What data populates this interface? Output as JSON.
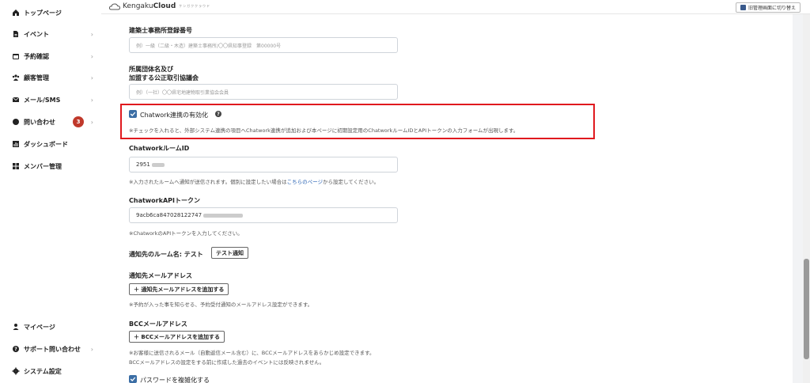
{
  "sidebar": {
    "items": [
      {
        "label": "トップページ",
        "icon": "home-icon",
        "chevron": ""
      },
      {
        "label": "イベント",
        "icon": "document-icon",
        "chevron": "›"
      },
      {
        "label": "予約確認",
        "icon": "calendar-icon",
        "chevron": "›"
      },
      {
        "label": "顧客管理",
        "icon": "users-icon",
        "chevron": "›"
      },
      {
        "label": "メール/SMS",
        "icon": "mail-icon",
        "chevron": "›"
      },
      {
        "label": "問い合わせ",
        "icon": "chat-icon",
        "chevron": "›",
        "badge": "3"
      },
      {
        "label": "ダッシュボード",
        "icon": "chart-icon",
        "chevron": ""
      },
      {
        "label": "メンバー管理",
        "icon": "grid-icon",
        "chevron": ""
      }
    ],
    "bottom_items": [
      {
        "label": "マイページ",
        "icon": "user-icon",
        "chevron": ""
      },
      {
        "label": "サポート問い合わせ",
        "icon": "help-icon",
        "chevron": "›"
      },
      {
        "label": "システム設定",
        "icon": "settings-icon",
        "chevron": ""
      }
    ]
  },
  "header": {
    "brand_prefix": "Kengaku",
    "brand_bold": "Cloud",
    "brand_sub": "ケンガククラウド",
    "admin_switch_label": "旧管理画面に切り替え"
  },
  "form": {
    "registry_label": "建築士事務所登録番号",
    "registry_placeholder": "例）一級（二級・木造）建築士事務所/〇〇県知事登録　第00000号",
    "org_label_line1": "所属団体名及び",
    "org_label_line2": "加盟する公正取引協議会",
    "org_placeholder": "例）（一社）〇〇県宅地建物取引業協会会員",
    "chatwork_enable_label": "Chatwork連携の有効化",
    "chatwork_enable_checked": true,
    "chatwork_enable_help": "※チェックを入れると、外部システム連携の項目へChatwork連携が追加および本ページに初期設定用のChatworkルームIDとAPIトークンの入力フォームが出現します。",
    "room_id_label": "ChatworkルームID",
    "room_id_value": "2951",
    "room_id_help_prefix": "※入力されたルームへ通知が送信されます。個別に設定したい場合は",
    "room_id_help_link": "こちらのページ",
    "room_id_help_suffix": "から設定してください。",
    "api_token_label": "ChatworkAPIトークン",
    "api_token_value": "9acb6ca847028122747",
    "api_token_help": "※ChatworkのAPIトークンを入力してください。",
    "notify_room_label": "通知先のルーム名: テスト",
    "test_notify_button": "テスト通知",
    "notify_email_label": "通知先メールアドレス",
    "add_notify_email_button": "＋ 通知先メールアドレスを追加する",
    "notify_email_help": "※予約が入った事を知らせる、予約受付通知のメールアドレス設定ができます。",
    "bcc_label": "BCCメールアドレス",
    "add_bcc_button": "＋ BCCメールアドレスを追加する",
    "bcc_help_line1": "※お客様に送信されるメール（自動返信メール含む）に、BCCメールアドレスをあらかじめ設定できます。",
    "bcc_help_line2": "BCCメールアドレスの設定をする前に作成した過去のイベントには反映されません。",
    "password_complex_label": "パスワードを複雑化する",
    "password_complex_checked": true
  },
  "colors": {
    "highlight_border": "#e0191e",
    "checkbox": "#3b6ea5",
    "badge": "#c0392b",
    "link": "#2a64b5"
  }
}
